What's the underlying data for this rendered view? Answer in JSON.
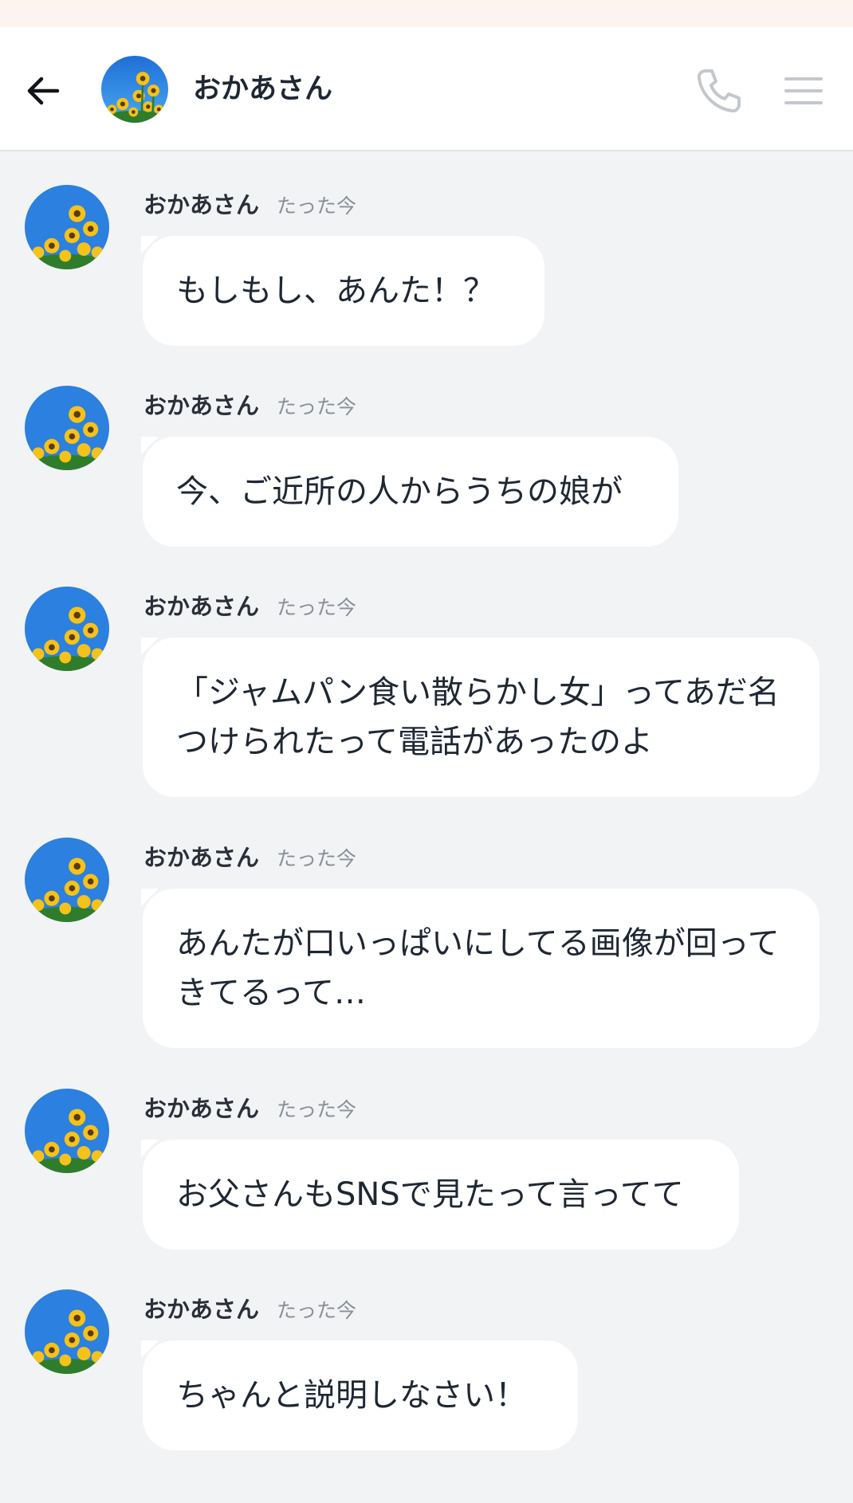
{
  "header": {
    "back_icon": "arrow-left-icon",
    "avatar_icon": "sunflower-avatar",
    "title": "おかあさん",
    "call_icon": "phone-icon",
    "menu_icon": "hamburger-menu-icon"
  },
  "colors": {
    "background": "#f2f3f5",
    "header": "#ffffff",
    "bubble": "#ffffff",
    "text": "#1f2733",
    "timestamp": "#8a8f98",
    "icon_gray": "#c4c7cc"
  },
  "messages": [
    {
      "sender": "おかあさん",
      "time": "たった今",
      "text": "もしもし、あんた！？"
    },
    {
      "sender": "おかあさん",
      "time": "たった今",
      "text": "今、ご近所の人からうちの娘が"
    },
    {
      "sender": "おかあさん",
      "time": "たった今",
      "text": "「ジャムパン食い散らかし女」ってあだ名つけられたって電話があったのよ"
    },
    {
      "sender": "おかあさん",
      "time": "たった今",
      "text": "あんたが口いっぱいにしてる画像が回ってきてるって…"
    },
    {
      "sender": "おかあさん",
      "time": "たった今",
      "text": "お父さんもSNSで見たって言ってて"
    },
    {
      "sender": "おかあさん",
      "time": "たった今",
      "text": "ちゃんと説明しなさい！"
    }
  ]
}
